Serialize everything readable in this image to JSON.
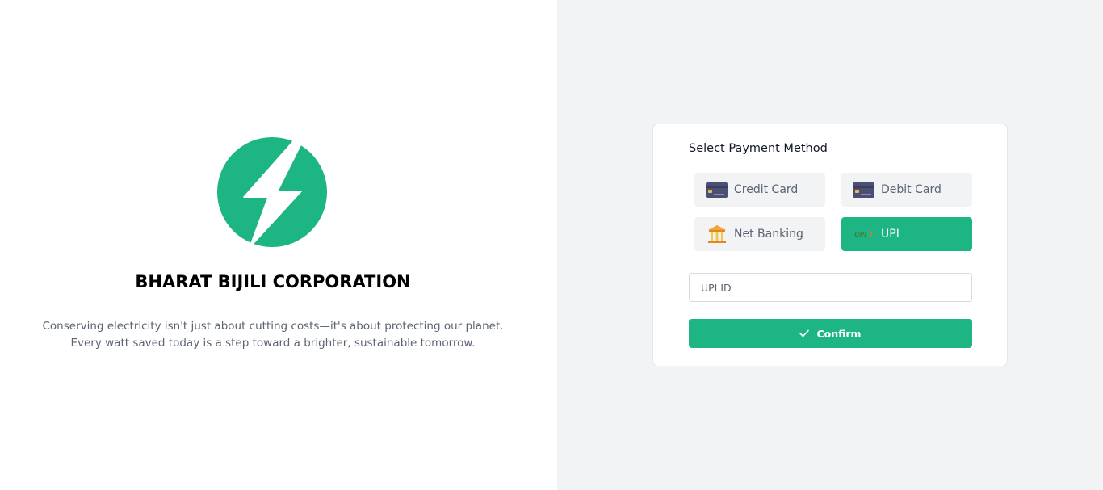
{
  "brand": {
    "name": "BHARAT BIJILI CORPORATION",
    "tagline": "Conserving electricity isn't just about cutting costs—it's about protecting our planet. Every watt saved today is a step toward a brighter, sustainable tomorrow.",
    "logo_icon": "lightning-bolt-icon",
    "accent_color": "#1db584"
  },
  "payment": {
    "title": "Select Payment Method",
    "methods": [
      {
        "label": "Credit Card",
        "icon": "credit-card-icon",
        "selected": false
      },
      {
        "label": "Debit Card",
        "icon": "debit-card-icon",
        "selected": false
      },
      {
        "label": "Net Banking",
        "icon": "bank-icon",
        "selected": false
      },
      {
        "label": "UPI",
        "icon": "upi-icon",
        "selected": true
      }
    ],
    "upi_placeholder": "UPI ID",
    "upi_value": "",
    "confirm_label": "Confirm",
    "confirm_icon": "check-icon"
  },
  "colors": {
    "left_bg": "#ffffff",
    "right_bg": "#f2f3f5",
    "method_bg": "#f2f3f5",
    "selected_bg": "#1db584"
  }
}
